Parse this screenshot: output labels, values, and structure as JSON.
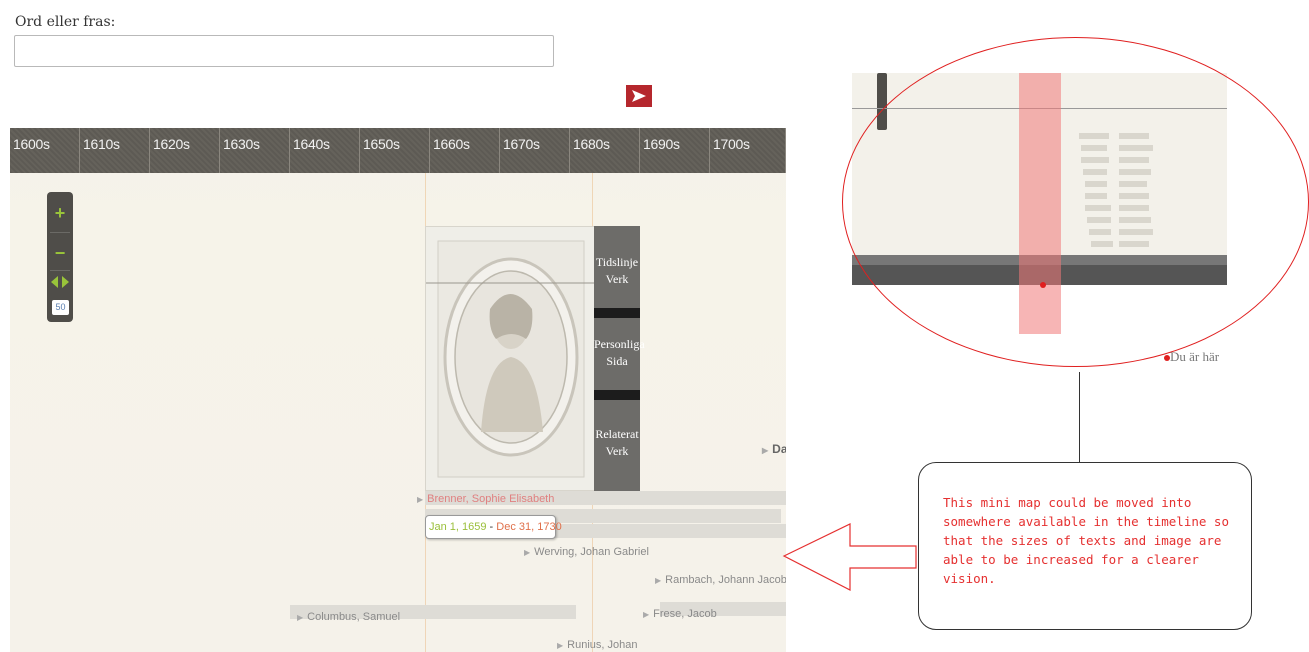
{
  "search": {
    "label": "Ord eller fras:",
    "value": "",
    "placeholder": ""
  },
  "go_button": {
    "icon": "play-arrow-icon",
    "color": "#b5272d"
  },
  "timeline": {
    "decades": [
      "1600s",
      "1610s",
      "1620s",
      "1630s",
      "1640s",
      "1650s",
      "1660s",
      "1670s",
      "1680s",
      "1690s",
      "1700s"
    ],
    "zoom": {
      "plus": "+",
      "minus": "−",
      "level": "50"
    },
    "menu": {
      "item1": [
        "Tidslinje",
        "Verk"
      ],
      "item2": [
        "Personliga",
        "Sida"
      ],
      "item3": [
        "Relaterat",
        "Verk"
      ]
    },
    "events": [
      {
        "name": "Brenner, Sophie Elisabeth",
        "highlight": true
      },
      {
        "name": "Werving, Johan Gabriel",
        "highlight": false
      },
      {
        "name": "Rambach, Johann Jacob",
        "highlight": false
      },
      {
        "name": "Columbus, Samuel",
        "highlight": false
      },
      {
        "name": "Frese, Jacob",
        "highlight": false
      },
      {
        "name": "Runius, Johan",
        "highlight": false
      },
      {
        "name": "Da",
        "highlight": false
      }
    ],
    "date_tip": {
      "start": "Jan 1, 1659",
      "sep": " - ",
      "end": "Dec 31, 1730"
    }
  },
  "minimap": {
    "here_label": "Du är här",
    "accent": "#e02020"
  },
  "callout": {
    "text": "This mini map could be moved into somewhere available in the timeline so that the sizes of texts and image are able to be increased for a clearer vision."
  }
}
